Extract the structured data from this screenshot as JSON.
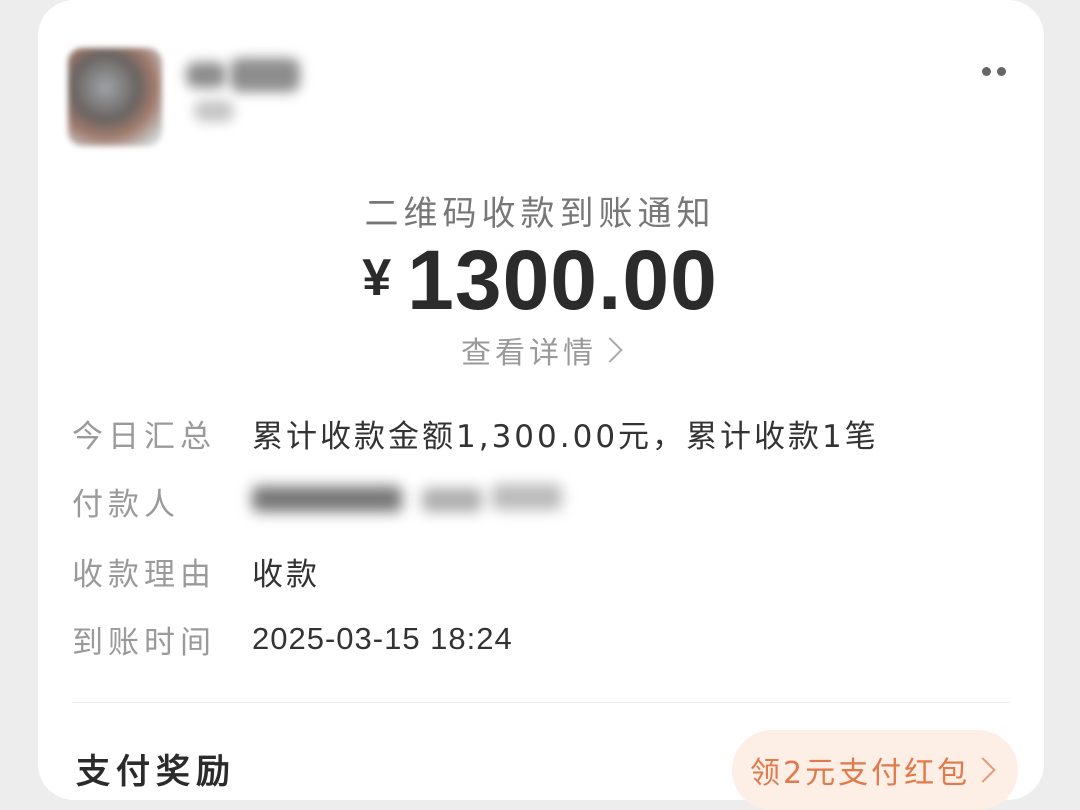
{
  "header": {
    "more_icon": "more-dots-icon"
  },
  "notice": {
    "title": "二维码收款到账通知",
    "currency": "¥",
    "amount": "1300.00",
    "details_link": "查看详情"
  },
  "fields": {
    "summary_label": "今日汇总",
    "summary_value": "累计收款金额1,300.00元，累计收款1笔",
    "payer_label": "付款人",
    "reason_label": "收款理由",
    "reason_value": "收款",
    "time_label": "到账时间",
    "time_value": "2025-03-15 18:24"
  },
  "rewards": {
    "title": "支付奖励",
    "promo": "领2元支付红包"
  },
  "colors": {
    "accent": "#e07a4a",
    "promo_bg": "#fdeee6"
  }
}
